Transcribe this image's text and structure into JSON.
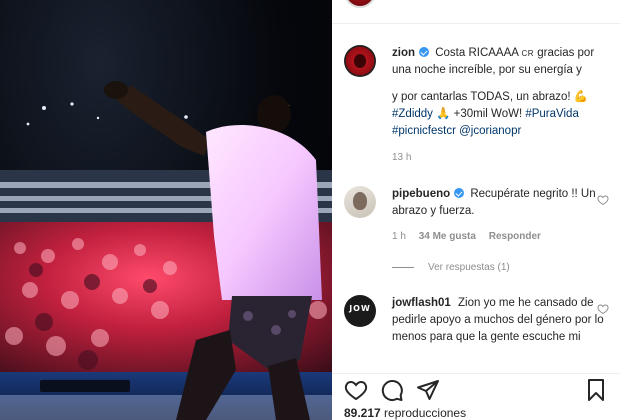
{
  "post": {
    "author": "zion",
    "caption_line1": "Costa RICAAAA",
    "caption_flag": "CR",
    "caption_line1b": "gracias por una noche increíble, por su energía y",
    "caption_line2": "y por cantarlas TODAS, un abrazo!",
    "hashtag_zdiddy": "#Zdiddy",
    "caption_count": "+30mil WoW!",
    "hashtag_puravida": "#PuraVida",
    "hashtag_picnic": "#picnicfestcr",
    "mention": "@jcorianopr",
    "time": "13 h"
  },
  "comments": [
    {
      "user": "pipebueno",
      "text": "Recupérate negrito !! Un abrazo y fuerza.",
      "time": "1 h",
      "likes": "34 Me gusta",
      "reply_label": "Responder",
      "view_replies": "Ver respuestas (1)"
    },
    {
      "user": "jowflash01",
      "avatar_text": "JOW",
      "text": "Zion yo me he cansado de pedirle apoyo a muchos del género por lo menos para que la gente escuche mi"
    }
  ],
  "footer": {
    "views_count": "89.217",
    "views_label": "reproducciones"
  },
  "icons": [
    "verified-badge-icon",
    "heart-icon",
    "comment-icon",
    "share-icon",
    "bookmark-icon",
    "prayer-hands-emoji",
    "bicep-emoji"
  ]
}
